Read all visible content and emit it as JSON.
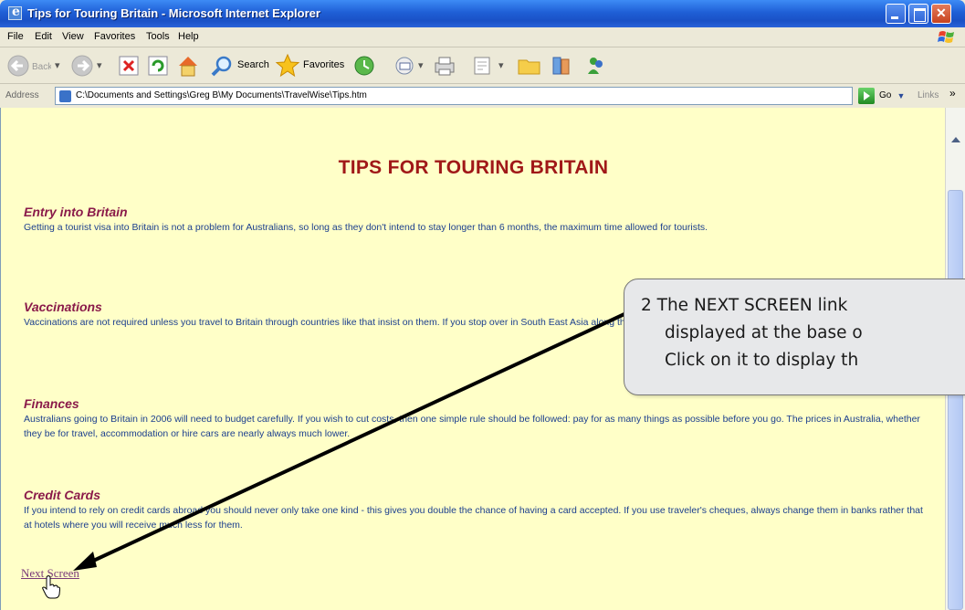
{
  "window": {
    "title": "Tips for Touring Britain - Microsoft Internet Explorer"
  },
  "menu": {
    "items": [
      "File",
      "Edit",
      "View",
      "Favorites",
      "Tools",
      "Help"
    ]
  },
  "toolbar": {
    "back_label": "Back",
    "search_label": "Search",
    "favorites_label": "Favorites"
  },
  "address": {
    "label": "Address",
    "url": "C:\\Documents and Settings\\Greg B\\My Documents\\TravelWise\\Tips.htm",
    "go_label": "Go",
    "links_label": "Links"
  },
  "page": {
    "heading": "TIPS FOR TOURING BRITAIN",
    "sections": [
      {
        "title": "Entry into Britain",
        "body": "Getting a tourist visa into Britain is not a problem for Australians, so long as they don't intend to stay longer than 6 months, the maximum time allowed for tourists."
      },
      {
        "title": "Vaccinations",
        "body": "Vaccinations are not required unless you travel to Britain through countries like that insist on them. If you stop over in South East Asia along the way, it is advisable to have cholera and typhoid vaccinations."
      },
      {
        "title": "Finances",
        "body": "Australians going to Britain in 2006 will need to budget carefully. If you wish to cut costs, then one simple rule should be followed: pay for as many things as possible before you go. The prices in Australia, whether they be for travel, accommodation or hire cars are nearly always much lower."
      },
      {
        "title": "Credit Cards",
        "body": "If you intend to rely on credit cards abroad you should never only take one kind - this gives you double the chance of having a card accepted. If you use traveler's cheques, always change them in banks rather that at hotels where you will receive much less for them."
      }
    ],
    "next_link": "Next Screen"
  },
  "callout": {
    "line1": "2  The NEXT SCREEN link",
    "line2": "displayed at the base o",
    "line3": "Click on it to display th"
  }
}
